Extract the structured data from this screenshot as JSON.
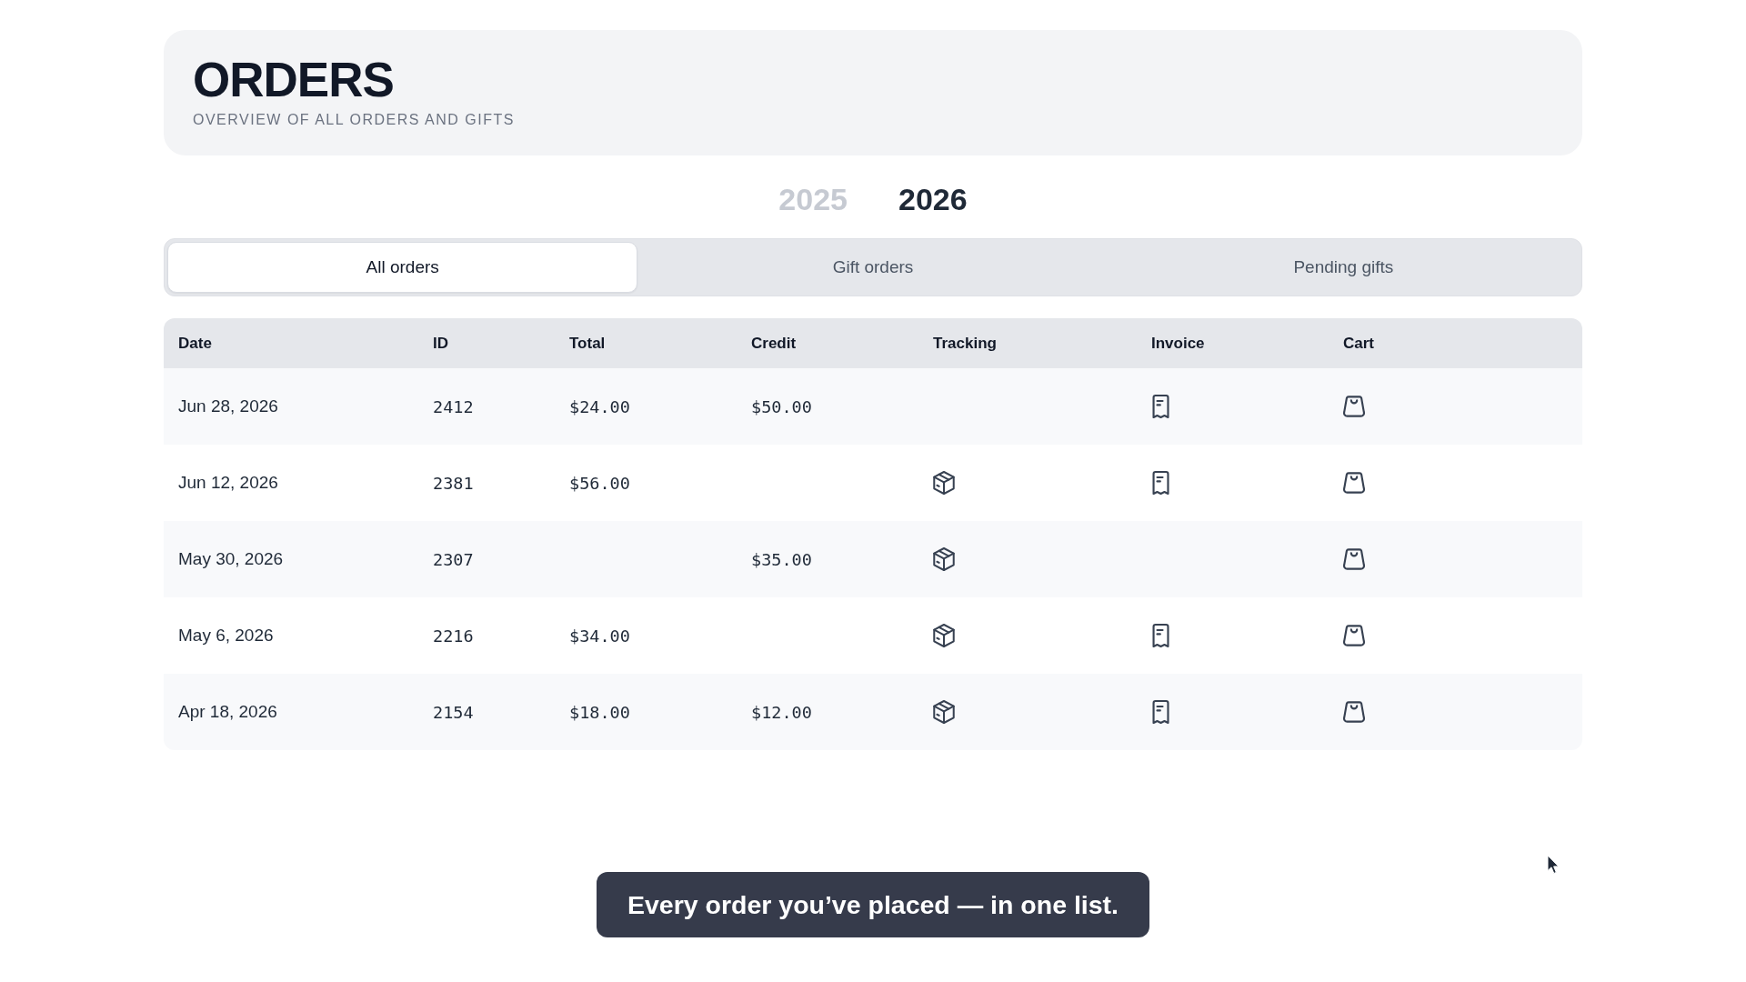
{
  "header": {
    "title": "ORDERS",
    "subtitle": "OVERVIEW OF ALL ORDERS AND GIFTS"
  },
  "years": [
    {
      "label": "2025",
      "selected": false
    },
    {
      "label": "2026",
      "selected": true
    }
  ],
  "tabs": [
    {
      "label": "All orders",
      "selected": true
    },
    {
      "label": "Gift orders",
      "selected": false
    },
    {
      "label": "Pending gifts",
      "selected": false
    }
  ],
  "table": {
    "columns": [
      "Date",
      "ID",
      "Total",
      "Credit",
      "Tracking",
      "Invoice",
      "Cart"
    ],
    "rows": [
      {
        "date": "Jun 28, 2026",
        "id": "2412",
        "total": "$24.00",
        "credit": "$50.00",
        "tracking": false,
        "invoice": true,
        "cart": true
      },
      {
        "date": "Jun 12, 2026",
        "id": "2381",
        "total": "$56.00",
        "tracking": true,
        "invoice": true,
        "cart": true
      },
      {
        "date": "May 30, 2026",
        "id": "2307",
        "credit": "$35.00",
        "tracking": true,
        "invoice": false,
        "cart": true
      },
      {
        "date": "May 6, 2026",
        "id": "2216",
        "total": "$34.00",
        "tracking": true,
        "invoice": true,
        "cart": true
      },
      {
        "date": "Apr 18, 2026",
        "id": "2154",
        "total": "$18.00",
        "credit": "$12.00",
        "tracking": true,
        "invoice": true,
        "cart": true
      }
    ]
  },
  "caption": "Every order you’ve placed — in one list."
}
